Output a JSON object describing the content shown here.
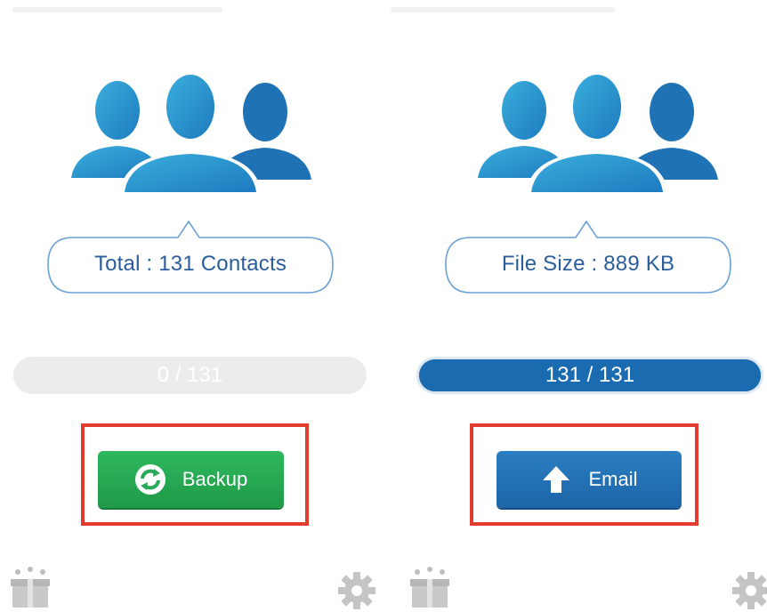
{
  "colors": {
    "accent_blue": "#1a6bb0",
    "success_green": "#27a957",
    "highlight_red": "#e43b2f",
    "bubble_outline": "#6aa1d6"
  },
  "left_panel": {
    "info_text": "Total : 131 Contacts",
    "progress_text": "0 / 131",
    "progress_fraction": 0,
    "button_label": "Backup",
    "button_icon": "refresh-icon",
    "bottom_left_icon": "gift-box-icon",
    "bottom_right_icon": "gear-icon"
  },
  "right_panel": {
    "info_text": "File Size : 889 KB",
    "progress_text": "131 / 131",
    "progress_fraction": 1,
    "button_label": "Email",
    "button_icon": "upload-arrow-icon",
    "bottom_left_icon": "gift-box-icon",
    "bottom_right_icon": "gear-icon"
  }
}
